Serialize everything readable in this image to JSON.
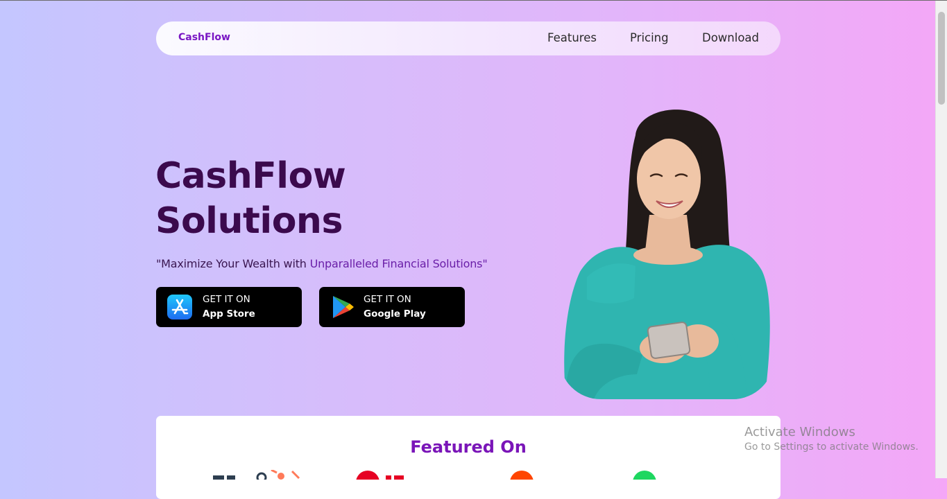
{
  "nav": {
    "brand": "CashFlow",
    "links": [
      "Features",
      "Pricing",
      "Download"
    ]
  },
  "hero": {
    "title_line1": "CashFlow",
    "title_line2": "Solutions",
    "tagline_plain": "\"Maximize Your Wealth with ",
    "tagline_accent": "Unparalleled Financial Solutions\""
  },
  "stores": {
    "app_store": {
      "line1": "GET IT ON",
      "line2": "App Store",
      "icon": "app-store-icon"
    },
    "google_play": {
      "line1": "GET IT ON",
      "line2": "Google Play",
      "icon": "google-play-icon"
    }
  },
  "featured": {
    "title": "Featured On"
  },
  "watermark": {
    "line1": "Activate Windows",
    "line2": "Go to Settings to activate Windows."
  },
  "colors": {
    "brand_purple": "#7a17c4",
    "title_dark": "#3b0a4d",
    "button_black": "#000000",
    "shirt_teal": "#2fb5b0"
  }
}
